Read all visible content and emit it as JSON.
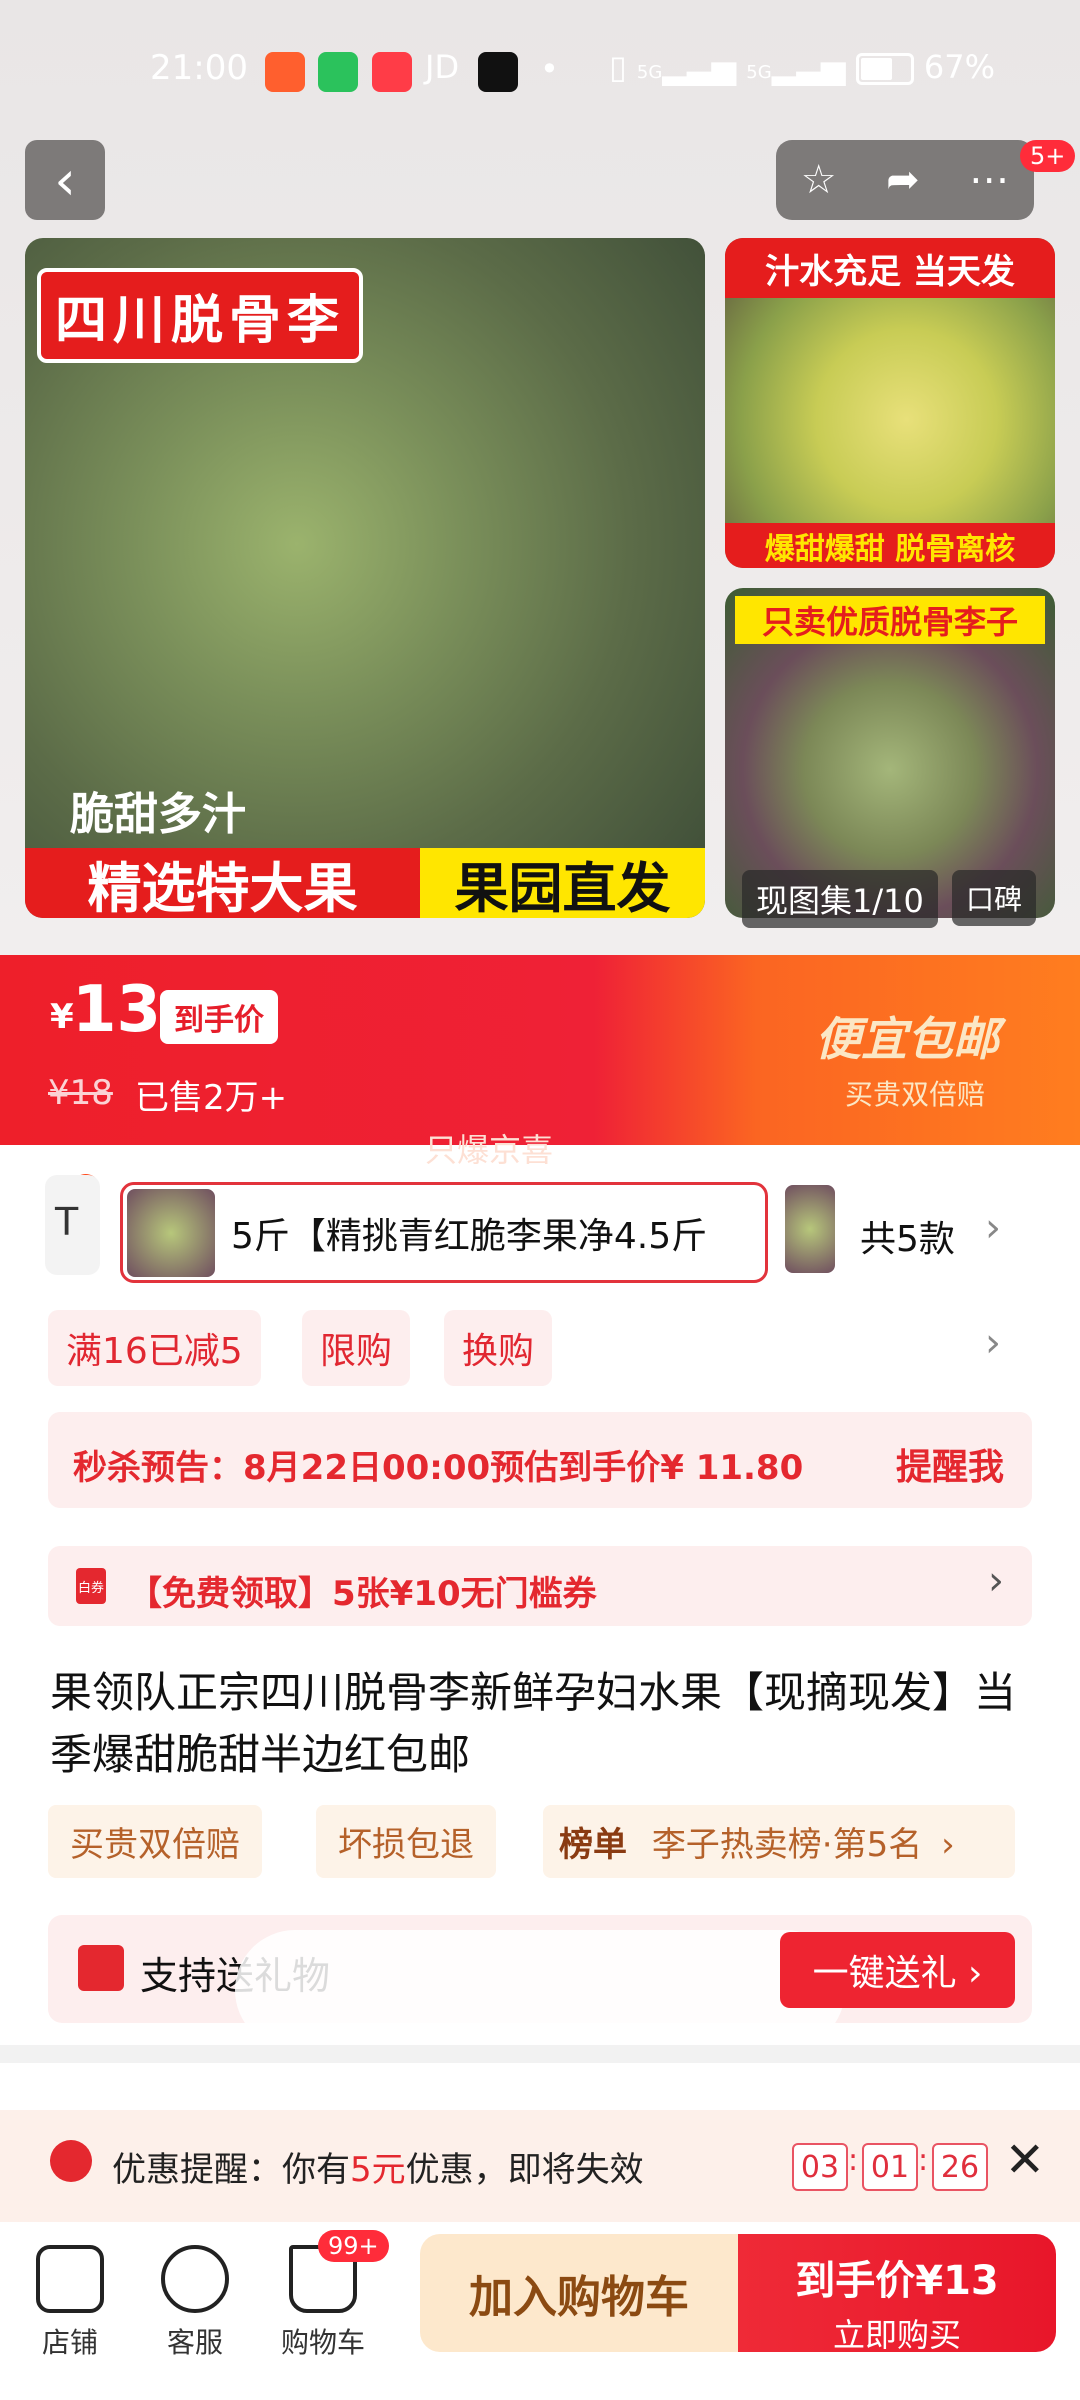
{
  "status_bar": {
    "time": "21:00",
    "jd": "JD",
    "dot": "•",
    "signal1": "5G",
    "signal2": "5G",
    "battery": "67%"
  },
  "hero": {
    "more_badge": "5+",
    "main_image": {
      "tag_top": "四川脱骨李",
      "caption": "脆甜多汁",
      "banner_left": "精选特大果",
      "banner_right": "果园直发"
    },
    "side1": {
      "top": "汁水充足 当天发",
      "bottom": "爆甜爆甜 脱骨离核"
    },
    "side2": {
      "top": "只卖优质脱骨李子"
    },
    "photo_counter": "现图集1/10",
    "reviews_label": "口碑"
  },
  "price": {
    "currency": "¥",
    "value": "13",
    "tag": "到手价",
    "original": "¥18",
    "sold": "已售2万+",
    "promo_title": "便宜包邮",
    "promo_sub": "买贵双倍赔",
    "only_text": "只爆京喜"
  },
  "variants": {
    "left_edge_text": "T",
    "selected_label": "5斤【精挑青红脆李果净4.5斤",
    "count_label": "共5款"
  },
  "chips": [
    "满16已减5",
    "限购",
    "换购"
  ],
  "seckill": {
    "label": "秒杀预告：8月22日00:00预估到手价¥ 11.80",
    "action": "提醒我"
  },
  "coupon": {
    "icon_text": "白券",
    "label": "【免费领取】5张¥10无门槛券"
  },
  "title": "果领队正宗四川脱骨李新鲜孕妇水果【现摘现发】当季爆甜脆甜半边红包邮",
  "services": {
    "s1": "买贵双倍赔",
    "s2": "坏损包退",
    "rank_title": "榜单",
    "rank_text": "李子热卖榜·第5名"
  },
  "gift": {
    "label": "支持送礼物",
    "button": "一键送礼 ›"
  },
  "reminder": {
    "label": "优惠提醒：你有",
    "amount": "5元",
    "suffix": "优惠，即将失效",
    "h": "03",
    "m": "01",
    "s": "26"
  },
  "bottom": {
    "shop": "店铺",
    "service": "客服",
    "cart": "购物车",
    "cart_badge": "99+",
    "add_cart": "加入购物车",
    "buy_price": "到手价¥13",
    "buy_now": "立即购买"
  },
  "colors": {
    "accent_red": "#e51d1d",
    "price_band_orange": "#ff7d1f",
    "coupon_bg": "#fdeeee"
  }
}
